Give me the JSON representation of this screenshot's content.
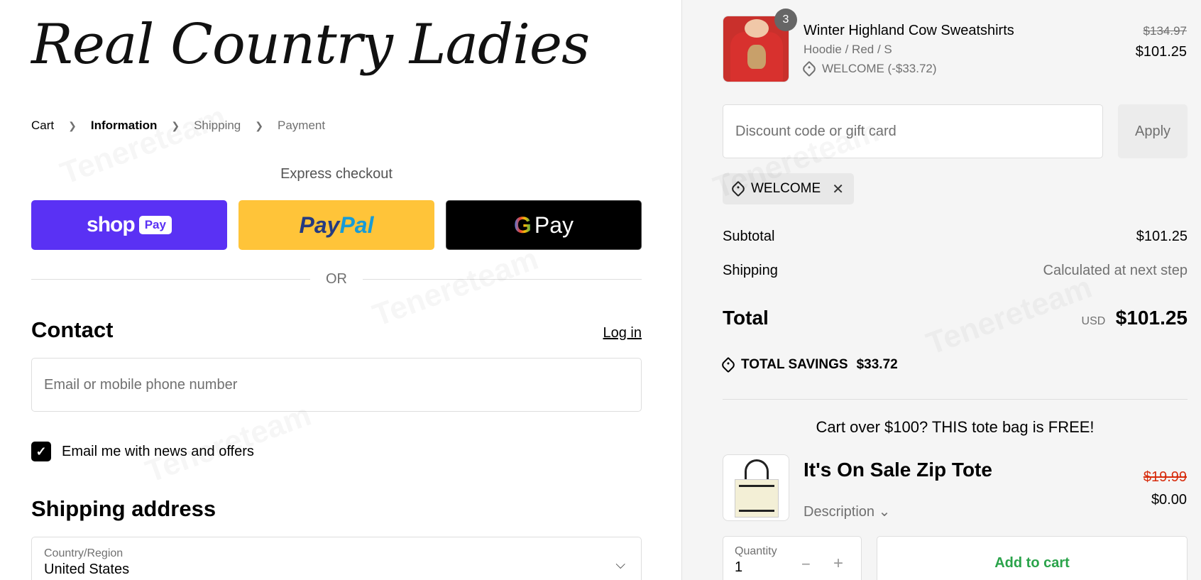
{
  "brand": {
    "logo_text": "Real Country Ladies"
  },
  "breadcrumb": {
    "cart": "Cart",
    "information": "Information",
    "shipping": "Shipping",
    "payment": "Payment"
  },
  "express": {
    "title": "Express checkout",
    "shop_word": "shop",
    "shop_pay": "Pay",
    "paypal_1": "Pay",
    "paypal_2": "Pal",
    "gpay_g": "G",
    "gpay_word": "Pay"
  },
  "or_label": "OR",
  "contact": {
    "title": "Contact",
    "login": "Log in",
    "email_placeholder": "Email or mobile phone number",
    "newsletter_label": "Email me with news and offers",
    "newsletter_checked": true
  },
  "shipping_address": {
    "title": "Shipping address",
    "country_label": "Country/Region",
    "country_value": "United States"
  },
  "cart": {
    "item1": {
      "quantity_badge": "3",
      "name": "Winter Highland Cow Sweatshirts",
      "variant": "Hoodie / Red / S",
      "discount": "WELCOME (-$33.72)",
      "original_price": "$134.97",
      "price": "$101.25"
    },
    "discount_placeholder": "Discount code or gift card",
    "apply": "Apply",
    "applied_code": "WELCOME",
    "subtotal_label": "Subtotal",
    "subtotal_value": "$101.25",
    "shipping_label": "Shipping",
    "shipping_value": "Calculated at next step",
    "total_label": "Total",
    "currency": "USD",
    "total_value": "$101.25",
    "savings_label": "TOTAL SAVINGS",
    "savings_value": "$33.72"
  },
  "upsell": {
    "promo": "Cart over $100? THIS tote bag is FREE!",
    "name": "It's On Sale Zip Tote",
    "description": "Description",
    "original_price": "$19.99",
    "price": "$0.00",
    "quantity_label": "Quantity",
    "quantity_value": "1",
    "add_to_cart": "Add to cart"
  },
  "watermark_text": "Tenereteam"
}
